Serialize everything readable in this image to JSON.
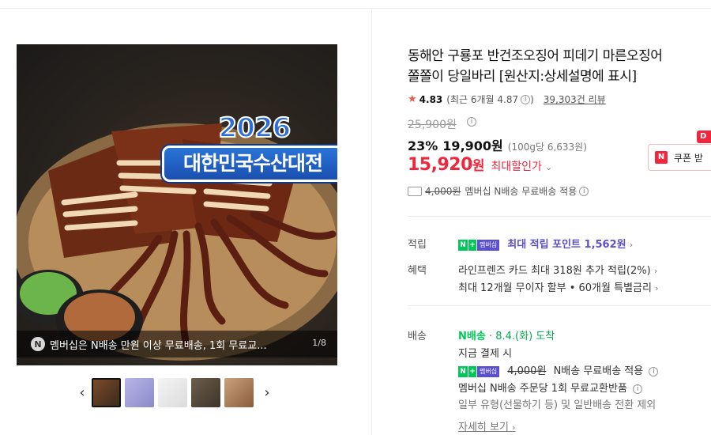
{
  "gallery": {
    "banner_year": "2026",
    "banner_title": "대한민국수산대전",
    "promo_icon": "N",
    "promo_text": "멤버십은 N배송 만원 이상 무료배송, 1회 무료교...",
    "counter": "1/8",
    "prev_arrow": "‹",
    "next_arrow": "›",
    "thumbnail_count": 5
  },
  "product": {
    "title_line1": "동해안 구룡포 반건조오징어 피데기 마른오징어",
    "title_line2": "쫄쫄이 당일바리 [원산지:상세설명에 표시]",
    "rating": "4.83",
    "rating_recent": "(최근 6개월 4.87",
    "rating_recent_close": ")",
    "reviews": "39,303건 리뷰",
    "original_price": "25,900원",
    "discount": "23%",
    "sale_price": "19,900원",
    "unit_price": "(100g당 6,633원)",
    "max_price": "15,920",
    "max_price_won": "원",
    "max_label": "최대할인가",
    "coupon_label": "쿠폰 받",
    "coupon_tag": "D",
    "shipping_fee": "4,000원",
    "shipping_text": "멤버십 N배송 무료배송 적용"
  },
  "points": {
    "label": "적립",
    "badge_n": "N",
    "badge_plus": "+",
    "badge_membership": "멤버십",
    "text": "최대 적립 포인트 1,562원"
  },
  "benefits": {
    "label": "혜택",
    "line1": "라인프렌즈 카드 최대 318원 추가 적립(2%)",
    "line2": "최대 12개월 무이자 할부 • 60개월 특별금리"
  },
  "delivery": {
    "label": "배송",
    "brand": "N배송",
    "dot": "·",
    "date": "8.4.(화) 도착",
    "pay_now": "지금 결제 시",
    "fee": "4,000원",
    "fee_text": "N배송 무료배송 적용",
    "exchange": "멤버십 N배송 주문당 1회 무료교환반품",
    "exclusion": "일부 유형(선물하기 등) 및 일반배송 전환 제외",
    "more": "자세히 보기"
  },
  "colors": {
    "accent_red": "#f0263c",
    "naver_green": "#03c75a",
    "membership_purple": "#5a4fcf"
  },
  "icons": [
    "info-icon",
    "star-icon",
    "truck-icon",
    "chevron-down-icon",
    "chevron-right-icon",
    "chevron-left-icon",
    "coupon-icon"
  ]
}
